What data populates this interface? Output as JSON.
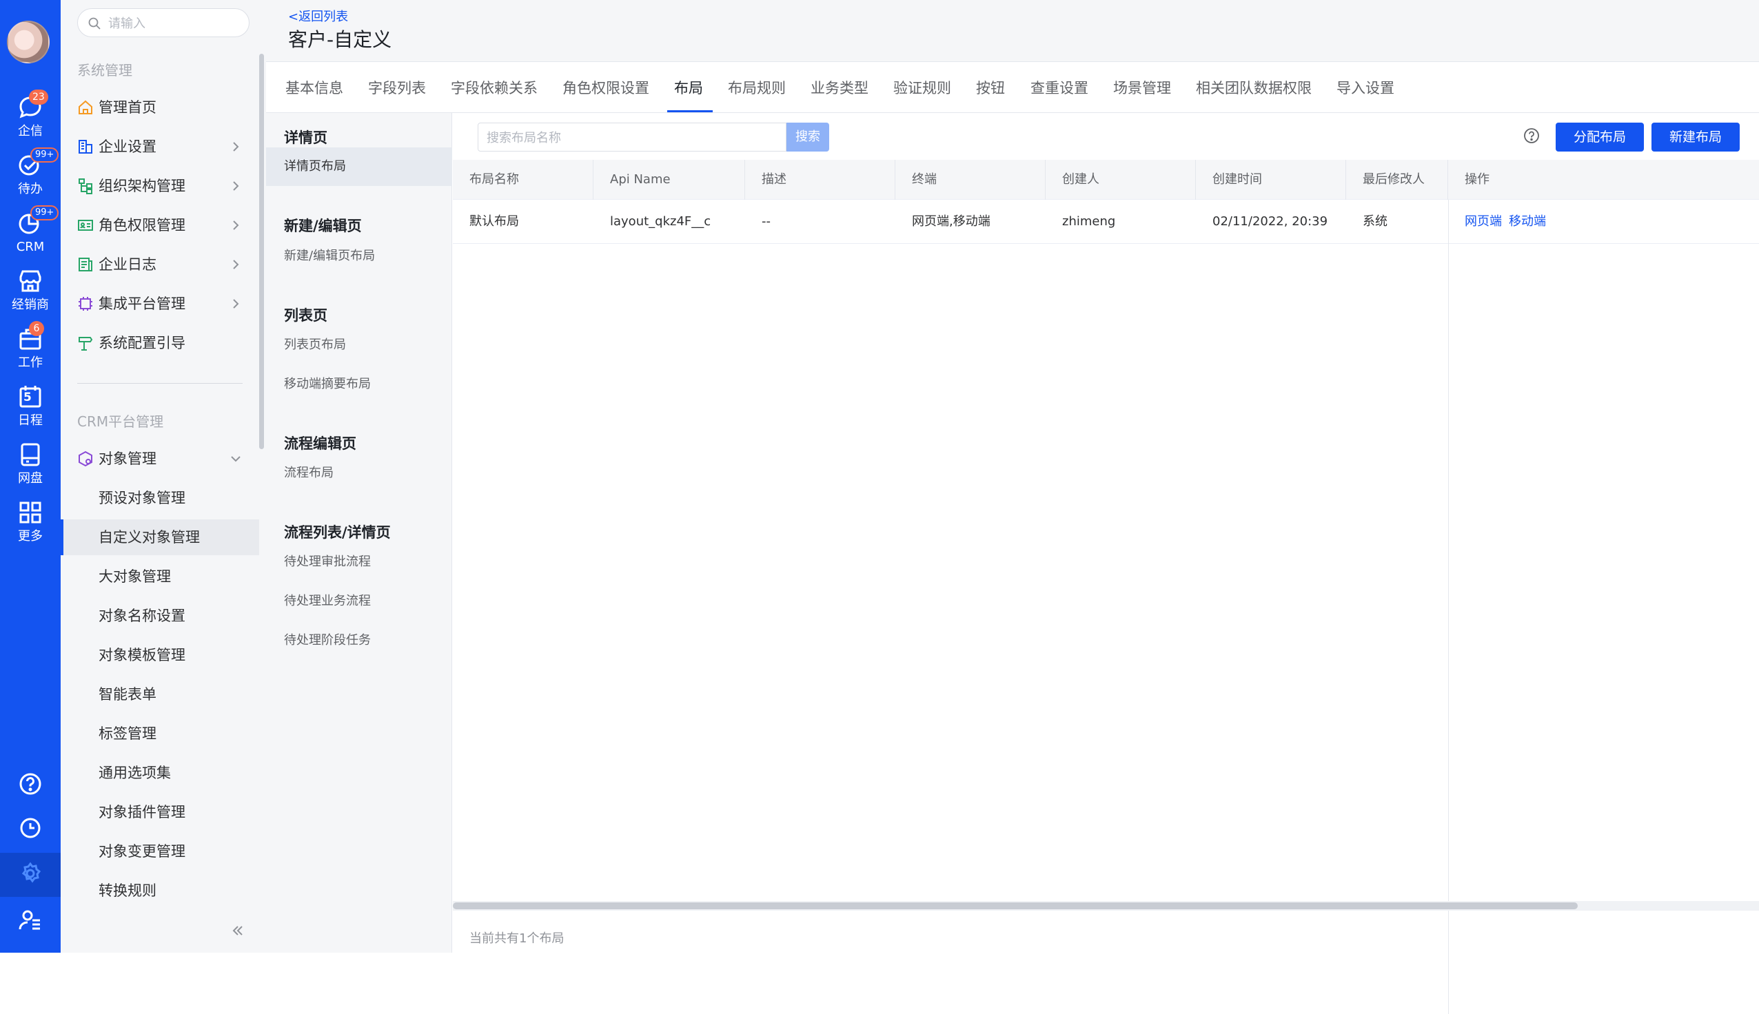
{
  "rail": {
    "items": [
      {
        "label": "企信",
        "badge": "23",
        "icon": "chat-bubble-icon"
      },
      {
        "label": "待办",
        "badge": "99+",
        "icon": "check-circle-icon"
      },
      {
        "label": "CRM",
        "badge": "99+",
        "icon": "pie-chart-icon"
      },
      {
        "label": "经销商",
        "badge": "",
        "icon": "store-icon"
      },
      {
        "label": "工作",
        "badge": "6",
        "icon": "briefcase-icon"
      },
      {
        "label": "日程",
        "badge": "",
        "icon": "calendar-icon",
        "day": "5"
      },
      {
        "label": "网盘",
        "badge": "",
        "icon": "drive-icon"
      },
      {
        "label": "更多",
        "badge": "",
        "icon": "grid-icon"
      }
    ],
    "accent": "#1454f0"
  },
  "sidebar": {
    "search_placeholder": "请输入",
    "section1": "系统管理",
    "items": [
      {
        "label": "管理首页",
        "icon": "home-icon",
        "color": "#f59a23"
      },
      {
        "label": "企业设置",
        "icon": "building-icon",
        "color": "#1454f0"
      },
      {
        "label": "组织架构管理",
        "icon": "org-tree-icon",
        "color": "#27a567"
      },
      {
        "label": "角色权限管理",
        "icon": "id-card-icon",
        "color": "#27a567"
      },
      {
        "label": "企业日志",
        "icon": "log-icon",
        "color": "#27a567"
      },
      {
        "label": "集成平台管理",
        "icon": "chip-icon",
        "color": "#8a4bd6"
      },
      {
        "label": "系统配置引导",
        "icon": "signpost-icon",
        "color": "#27a567"
      }
    ],
    "section2": "CRM平台管理",
    "object_mgmt": {
      "label": "对象管理",
      "icon": "cube-gear-icon"
    },
    "subitems": [
      "预设对象管理",
      "自定义对象管理",
      "大对象管理",
      "对象名称设置",
      "对象模板管理",
      "智能表单",
      "标签管理",
      "通用选项集",
      "对象插件管理",
      "对象变更管理",
      "转换规则"
    ]
  },
  "header": {
    "back": "<返回列表",
    "title": "客户-自定义"
  },
  "tabs": [
    "基本信息",
    "字段列表",
    "字段依赖关系",
    "角色权限设置",
    "布局",
    "布局规则",
    "业务类型",
    "验证规则",
    "按钮",
    "查重设置",
    "场景管理",
    "相关团队数据权限",
    "导入设置"
  ],
  "categories": {
    "detail": {
      "head": "详情页",
      "items": [
        "详情页布局"
      ]
    },
    "edit": {
      "head": "新建/编辑页",
      "items": [
        "新建/编辑页布局"
      ]
    },
    "list": {
      "head": "列表页",
      "items": [
        "列表页布局",
        "移动端摘要布局"
      ]
    },
    "flow_edit": {
      "head": "流程编辑页",
      "items": [
        "流程布局"
      ]
    },
    "flow_list": {
      "head": "流程列表/详情页",
      "items": [
        "待处理审批流程",
        "待处理业务流程",
        "待处理阶段任务"
      ]
    }
  },
  "toolbar": {
    "search_placeholder": "搜索布局名称",
    "search_btn": "搜索",
    "assign_btn": "分配布局",
    "new_btn": "新建布局"
  },
  "table": {
    "columns": [
      "布局名称",
      "Api Name",
      "描述",
      "终端",
      "创建人",
      "创建时间",
      "最后修改人",
      "操作"
    ],
    "rows": [
      {
        "name": "默认布局",
        "api": "layout_qkz4F__c",
        "desc": "--",
        "terminal": "网页端,移动端",
        "creator": "zhimeng",
        "created": "02/11/2022, 20:39",
        "modifier": "系统",
        "ops": [
          "网页端",
          "移动端"
        ]
      }
    ],
    "footer": "当前共有1个布局"
  }
}
